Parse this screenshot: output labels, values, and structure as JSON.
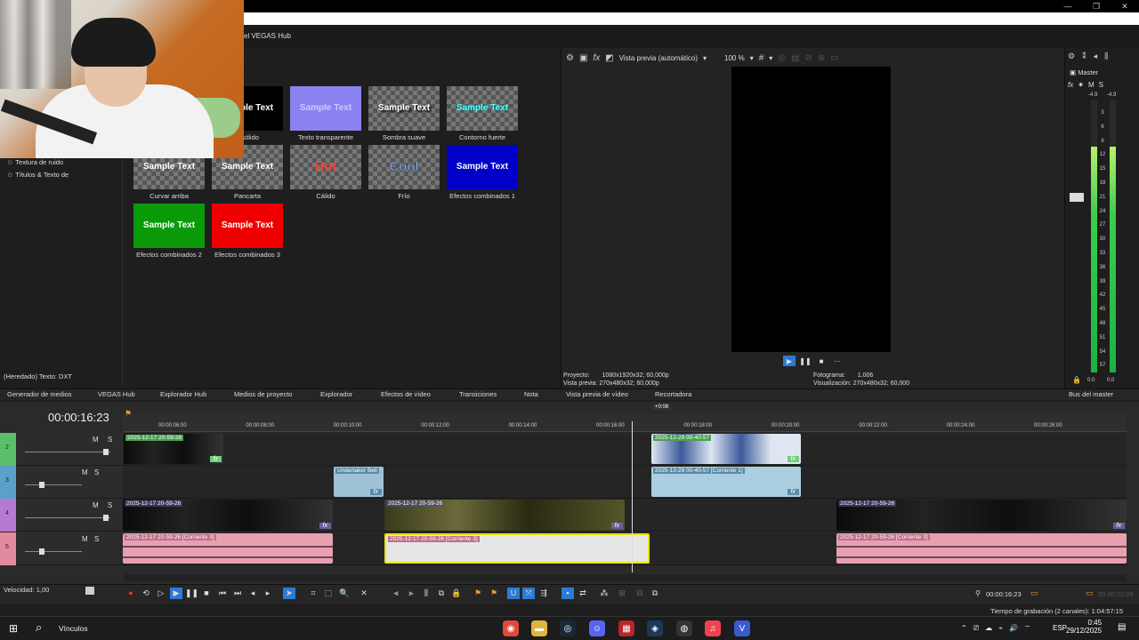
{
  "window": {
    "minimize": "—",
    "restore": "❐",
    "close": "✕"
  },
  "hub_title": "el VEGAS Hub",
  "left_tree": {
    "items": [
      "Textura de ruido",
      "Títulos & Texto de"
    ],
    "footer": "(Heredado) Texto: DXT"
  },
  "presets": [
    {
      "thumb": "Sample Text",
      "label": "o sólido",
      "style": "solid"
    },
    {
      "thumb": "Sample Text",
      "label": "Texto transparente",
      "style": "transparent"
    },
    {
      "thumb": "Sample Text",
      "label": "Sombra suave",
      "style": "shadow"
    },
    {
      "thumb": "Sample Text",
      "label": "Contorno fuerte",
      "style": "outline"
    },
    {
      "thumb": "Sample Text",
      "label": "Curvar arriba",
      "style": "curve"
    },
    {
      "thumb": "Sample Text",
      "label": "Pancarta",
      "style": "banner"
    },
    {
      "thumb": "Hot",
      "label": "Cálido",
      "style": "hot"
    },
    {
      "thumb": "Cool",
      "label": "Frío",
      "style": "cool"
    },
    {
      "thumb": "Sample Text",
      "label": "Efectos combinados 1",
      "style": "combo1"
    },
    {
      "thumb": "Sample Text",
      "label": "Efectos combinados 2",
      "style": "combo2"
    },
    {
      "thumb": "Sample Text",
      "label": "Efectos combinados 3",
      "style": "combo3"
    }
  ],
  "preview": {
    "mode": "Vista previa (automático)",
    "zoom": "100 %",
    "project_label": "Proyecto:",
    "project_value": "1080x1920x32; 60,000p",
    "preview_label": "Vista previa:",
    "preview_value": "270x480x32; 60,000p",
    "frame_label": "Fotograma:",
    "frame_value": "1.006",
    "display_label": "Visualización:",
    "display_value": "270x480x32; 60,000"
  },
  "master": {
    "title": "Master",
    "fx": "fx",
    "m": "M",
    "s": "S",
    "peak_left": "-4.9",
    "peak_right": "-4.9",
    "scale": [
      "3",
      "6",
      "9",
      "12",
      "15",
      "18",
      "21",
      "24",
      "27",
      "30",
      "33",
      "36",
      "39",
      "42",
      "45",
      "48",
      "51",
      "54",
      "57"
    ],
    "bottom_left": "0.0",
    "bottom_right": "0.0",
    "level_left": 0.83,
    "level_right": 0.83
  },
  "tabs": [
    "Generador de medios",
    "VEGAS Hub",
    "Explorador Hub",
    "Medios de proyecto",
    "Explorador",
    "Efectos de vídeo",
    "Transiciones",
    "Nota",
    "Vista previa de vídeo",
    "Recortadora",
    "Bus del master"
  ],
  "timeline": {
    "timecode": "00:00:16:23",
    "ruler": [
      "00:00:06:00",
      "00:00:08:00",
      "00:00:10:00",
      "00:00:12:00",
      "00:00:14:00",
      "00:00:16:00",
      "00:00:18:00",
      "00:00:20:00",
      "00:00:22:00",
      "00:00:24:00",
      "00:00:26:00"
    ],
    "marker": "+0:08",
    "tracks": [
      {
        "num": "2",
        "m": "M",
        "s": "S",
        "color": "#5bbf6a"
      },
      {
        "num": "3",
        "m": "M",
        "s": "S",
        "color": "#5aa0c8"
      },
      {
        "num": "4",
        "m": "M",
        "s": "S",
        "color": "#b67bd0"
      },
      {
        "num": "5",
        "m": "M",
        "s": "S",
        "color": "#e28aa0"
      }
    ],
    "clip_labels": {
      "c1": "2025-12-17 20-59-26",
      "c2": "2025-12-29 00-40-57",
      "c3": "Undertaker Bell",
      "c4": "2025-12-29 00-40-57 [Corriente 1]",
      "c5": "2025-12-17 20-59-26",
      "c6": "2025-12-17 20-59-26",
      "c7": "2025-12-17 20-59-26",
      "c8": "2025-12-17 20-59-26 [Corriente 3]",
      "c9": "2025-12-17 20-59-26 [Corriente 3]",
      "c10": "2025-12-17 20-59-26 [Corriente 3]"
    },
    "fx": "fx",
    "dots": "···"
  },
  "transport": {
    "speed": "Velocidad: 1,00",
    "end_tc": "00:00:16:23",
    "right_tc": "00:00:02:09"
  },
  "status": {
    "record_time": "Tiempo de grabación (2 canales): 1:04:57:15"
  },
  "taskbar": {
    "search_label": "Vínculos",
    "lang": "ESP",
    "time": "0:45",
    "date": "29/12/2025"
  },
  "colors": {
    "accent": "#2b7bd5",
    "audio_clip": "#e8a0b0",
    "meter": "#3dcc4d"
  }
}
